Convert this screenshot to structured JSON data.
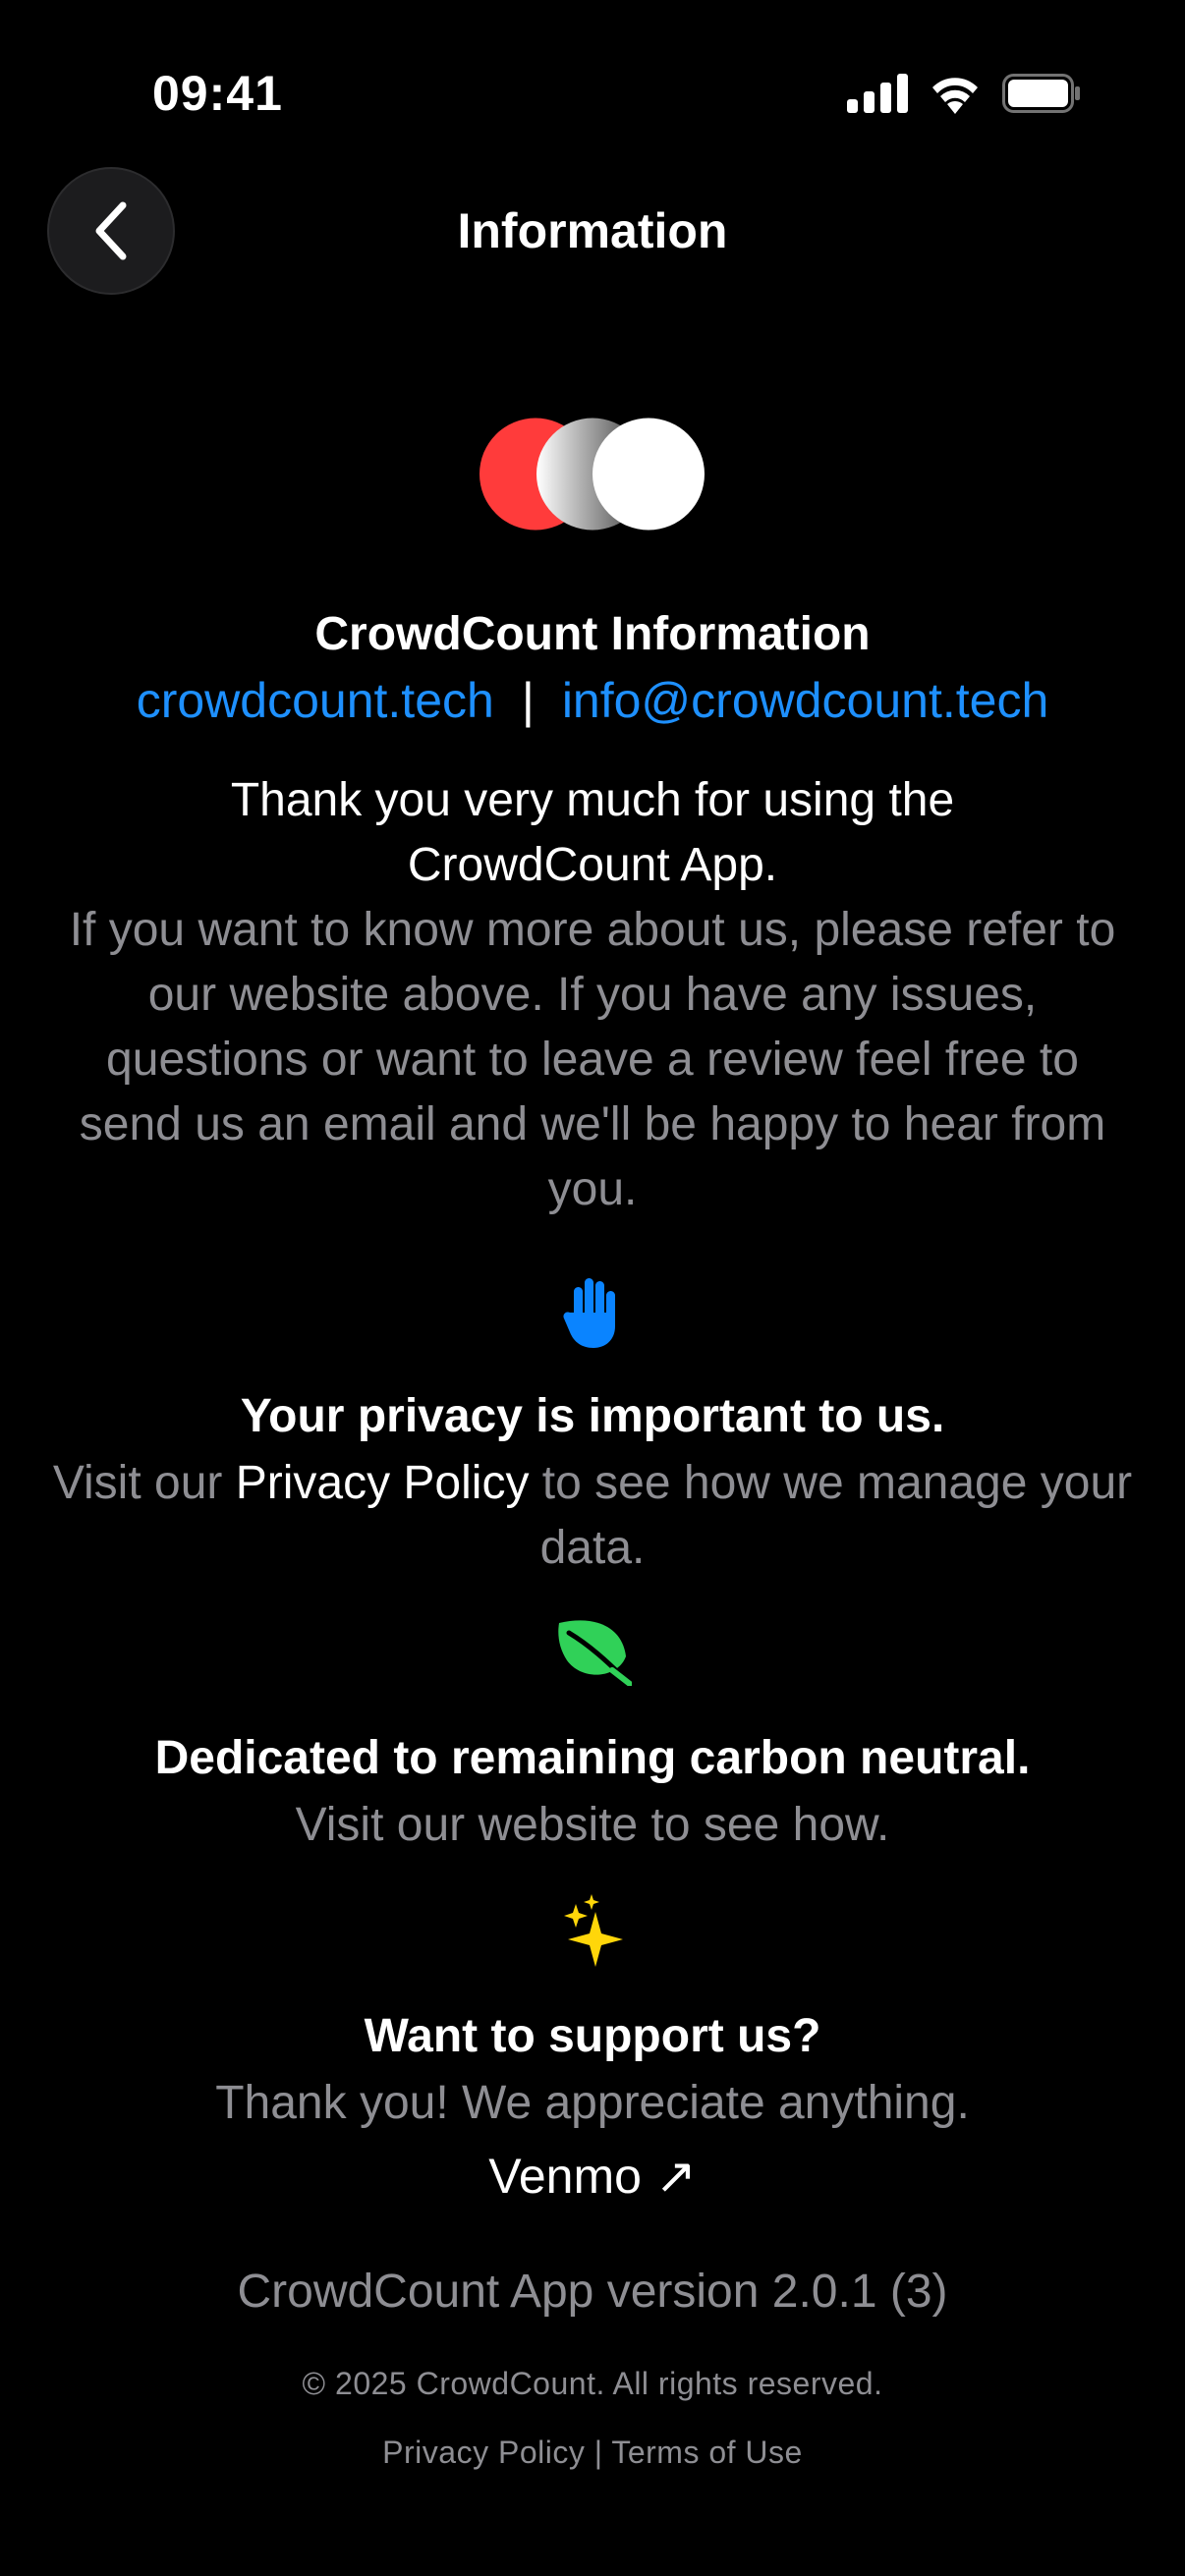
{
  "status_bar": {
    "time": "09:41",
    "icons": [
      "cellular-signal-icon",
      "wifi-icon",
      "battery-icon"
    ]
  },
  "nav": {
    "title": "Information",
    "back_icon": "chevron-left-icon"
  },
  "header": {
    "logo_icon": "crowdcount-logo",
    "title": "CrowdCount Information",
    "website_link": "crowdcount.tech",
    "separator": "|",
    "email_link": "info@crowdcount.tech"
  },
  "intro": {
    "thanks": "Thank you very much for using the CrowdCount App.",
    "body": "If you want to know more about us, please refer to our website above. If you have any issues, questions or want to leave a review feel free to send us an email and we'll be happy to hear from you."
  },
  "privacy": {
    "icon": "raised-hand-icon",
    "title": "Your privacy is important to us.",
    "text_before": "Visit our ",
    "link": "Privacy Policy",
    "text_after": " to see how we manage your data."
  },
  "carbon": {
    "icon": "leaf-icon",
    "title": "Dedicated to remaining carbon neutral.",
    "subtitle": "Visit our website to see how."
  },
  "support": {
    "icon": "sparkles-icon",
    "title": "Want to support us?",
    "subtitle": "Thank you! We appreciate anything.",
    "venmo_label": "Venmo ↗"
  },
  "footer": {
    "version": "CrowdCount App version 2.0.1 (3)",
    "copyright": "© 2025 CrowdCount. All rights reserved.",
    "privacy_link": "Privacy Policy",
    "separator": "|",
    "terms_link": "Terms of Use"
  },
  "colors": {
    "background": "#000000",
    "link_blue": "#1e90ff",
    "muted_grey": "#8e8e93",
    "icon_blue": "#0a84ff",
    "leaf_green": "#30d158",
    "sparkle_yellow": "#ffd60a",
    "logo_red": "#ff3b3b"
  }
}
